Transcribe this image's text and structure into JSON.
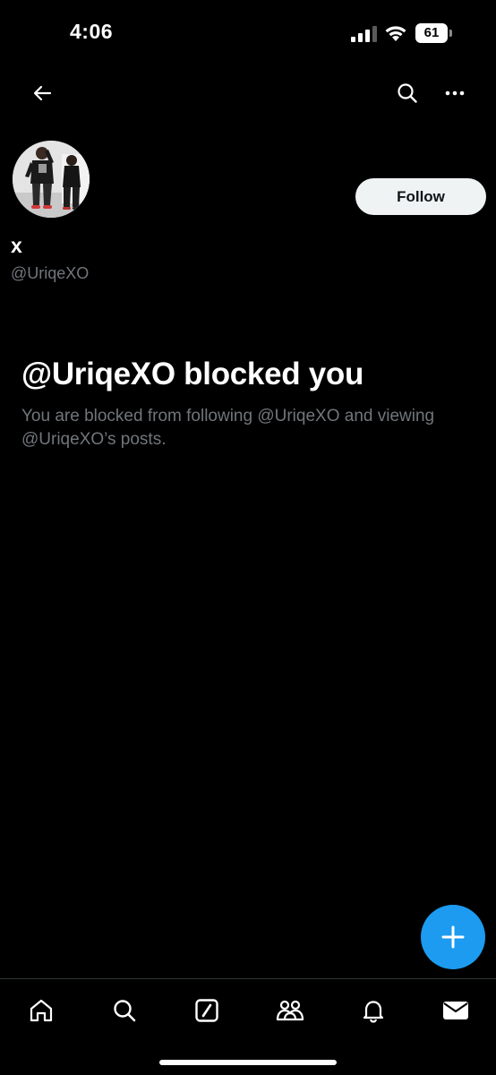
{
  "status_bar": {
    "time": "4:06",
    "battery": "61"
  },
  "profile": {
    "display_name": "x",
    "handle": "@UriqeXO",
    "follow_label": "Follow"
  },
  "blocked": {
    "title": "@UriqeXO blocked you",
    "description": "You are blocked from following @UriqeXO and viewing @UriqeXO’s posts."
  },
  "icons": {
    "back": "arrow-left-icon",
    "search": "search-icon",
    "more": "more-dots-icon",
    "compose": "plus-icon",
    "tabs": [
      "home-icon",
      "search-icon",
      "grok-icon",
      "communities-icon",
      "notifications-icon",
      "messages-icon"
    ]
  },
  "colors": {
    "background": "#000000",
    "accent": "#1d9bf0",
    "secondary_text": "#71767b",
    "follow_button_bg": "#eff3f4"
  }
}
